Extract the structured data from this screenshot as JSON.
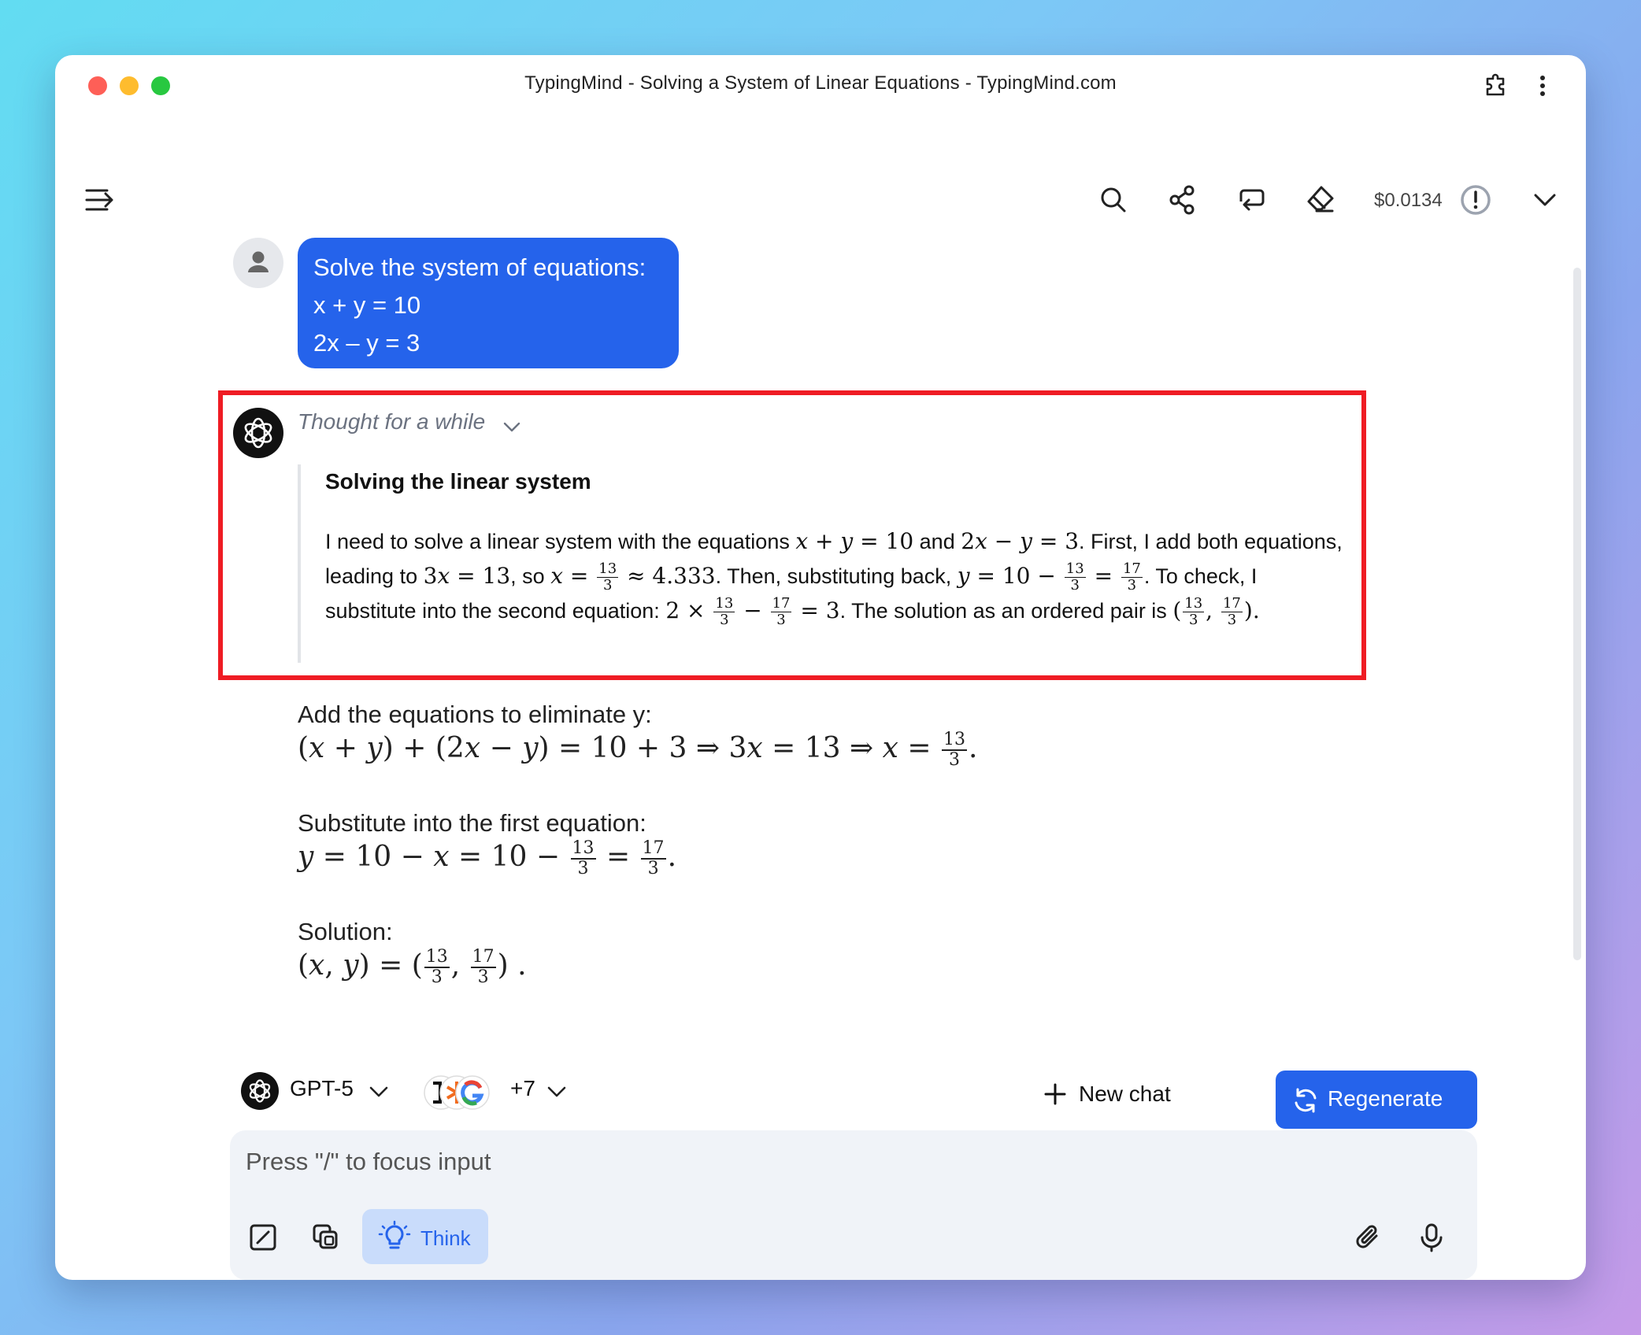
{
  "window": {
    "title": "TypingMind - Solving a System of Linear Equations - TypingMind.com"
  },
  "header": {
    "cost": "$0.0134"
  },
  "user_message": {
    "lines": [
      "Solve the system of equations:",
      "x + y = 10",
      "2x – y = 3"
    ]
  },
  "assistant": {
    "thought_label": "Thought for a while",
    "thought_title": "Solving the linear system",
    "thought_text": {
      "t1": "I need to solve a linear system with the equations",
      "t2": "and",
      "t3": ". First, I add both equations, leading to",
      "t4": ", so",
      "t5": ". Then, substituting back,",
      "t6": ". To check, I substitute into the second equation:",
      "t7": ". The solution as an ordered pair is"
    },
    "steps": [
      {
        "label": "Add the equations to eliminate y:"
      },
      {
        "label": "Substitute into the first equation:"
      },
      {
        "label": "Solution:"
      }
    ]
  },
  "footer": {
    "model": "GPT-5",
    "extra_models": "+7",
    "new_chat": "New chat",
    "regenerate": "Regenerate",
    "input_placeholder": "Press \"/\" to focus input",
    "think": "Think"
  },
  "colors": {
    "accent": "#2563eb",
    "highlight": "#ef1c24",
    "think_bg": "#c9dcfb"
  }
}
